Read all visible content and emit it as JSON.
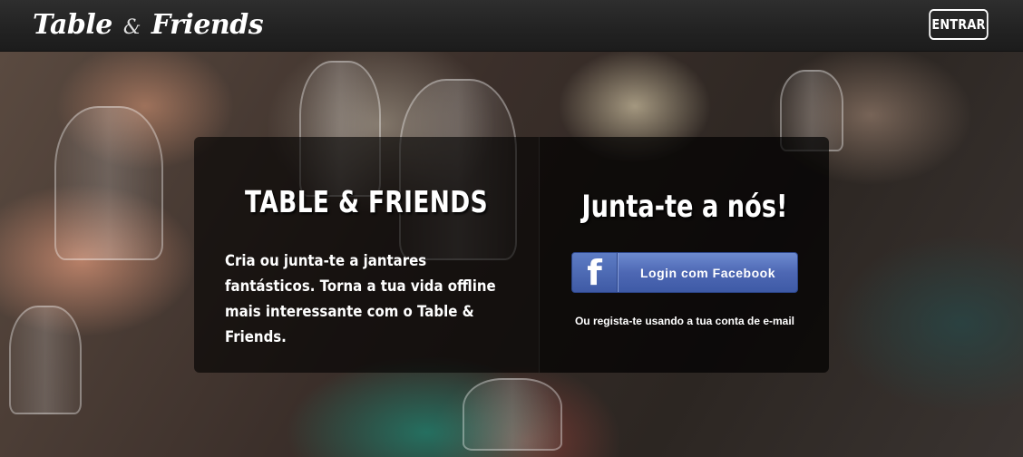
{
  "header": {
    "logo_left": "Table",
    "logo_amp": "&",
    "logo_right": "Friends",
    "enter_label": "ENTRAR"
  },
  "hero": {
    "brand_title": "TABLE & FRIENDS",
    "brand_text": "Cria ou junta-te a jantares fantásticos. Torna a tua vida offline mais interessante com o Table & Friends.",
    "join_title": "Junta-te a nós!",
    "facebook_button_label": "Login com Facebook",
    "facebook_icon": "facebook-f-icon",
    "email_link": "Ou regista-te usando a tua conta de e-mail"
  },
  "colors": {
    "header_bg": "#262626",
    "facebook_blue": "#4e68b4",
    "panel_overlay": "rgba(0,0,0,0.62)"
  }
}
